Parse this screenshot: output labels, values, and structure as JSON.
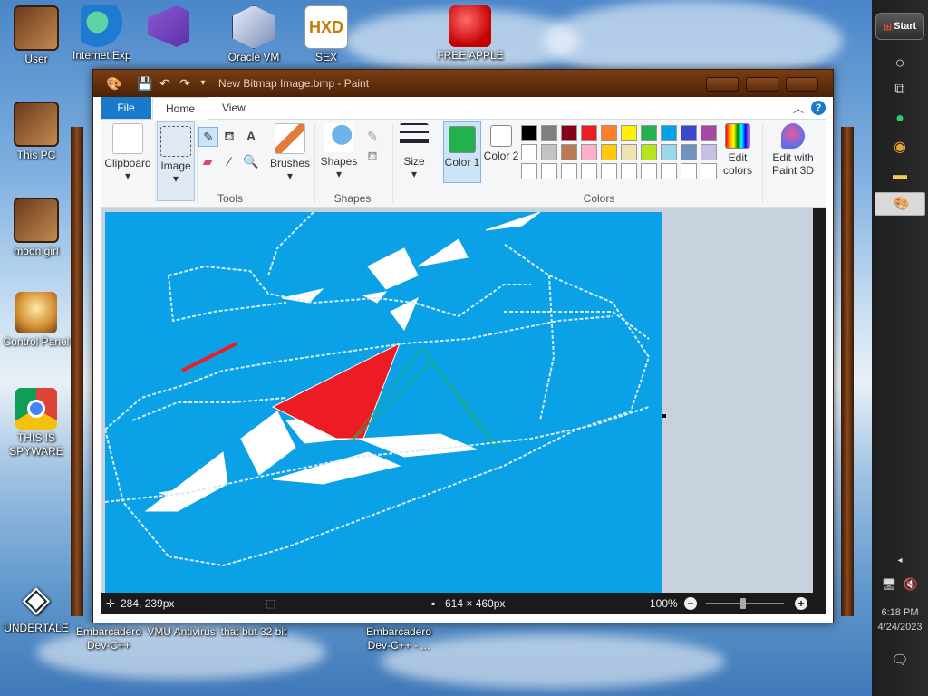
{
  "desktop": {
    "icons": [
      {
        "label": "User"
      },
      {
        "label": "Internet Explorer"
      },
      {
        "label": "Oracle VM"
      },
      {
        "label": "SEX"
      },
      {
        "label": "FREE APPLE"
      },
      {
        "label": "This PC"
      },
      {
        "label": "moon girl"
      },
      {
        "label": "Control Panel"
      },
      {
        "label": "THIS IS SPYWARE"
      },
      {
        "label": "UNDERTALE"
      },
      {
        "label": "Embarcadero Dev-C++"
      },
      {
        "label": "VMU Antivirus"
      },
      {
        "label": "that but 32 bit"
      },
      {
        "label": "Embarcadero Dev-C++ - ..."
      }
    ],
    "hxd_logo": "HXD"
  },
  "taskbar": {
    "start_label": "Start",
    "time": "6:18 PM",
    "date": "4/24/2023"
  },
  "window": {
    "title": "New Bitmap Image.bmp - Paint",
    "tabs": {
      "file": "File",
      "home": "Home",
      "view": "View"
    },
    "help": "?",
    "ribbon": {
      "clipboard": "Clipboard",
      "image": "Image",
      "tools": "Tools",
      "brushes": "Brushes",
      "shapes_btn": "Shapes",
      "shapes_group": "Shapes",
      "size": "Size",
      "color1": "Color 1",
      "color2": "Color 2",
      "edit_colors": "Edit colors",
      "edit_paint3d": "Edit with Paint 3D",
      "colors_group": "Colors",
      "text_tool": "A"
    },
    "palette": [
      "#000000",
      "#7f7f7f",
      "#880015",
      "#ed1c24",
      "#ff7f27",
      "#fff200",
      "#22b14c",
      "#00a2e8",
      "#3f48cc",
      "#a349a4",
      "#ffffff",
      "#c3c3c3",
      "#b97a57",
      "#ffaec9",
      "#ffc90e",
      "#efe4b0",
      "#b5e61d",
      "#99d9ea",
      "#7092be",
      "#c8bfe7",
      "#ffffff",
      "#ffffff",
      "#ffffff",
      "#ffffff",
      "#ffffff",
      "#ffffff",
      "#ffffff",
      "#ffffff",
      "#ffffff",
      "#ffffff"
    ],
    "color1_value": "#22b14c",
    "color2_value": "#ffffff",
    "canvas_bg": "#0aa1e6",
    "status": {
      "cursor": "284, 239px",
      "image_size": "614 × 460px",
      "zoom": "100%"
    }
  }
}
